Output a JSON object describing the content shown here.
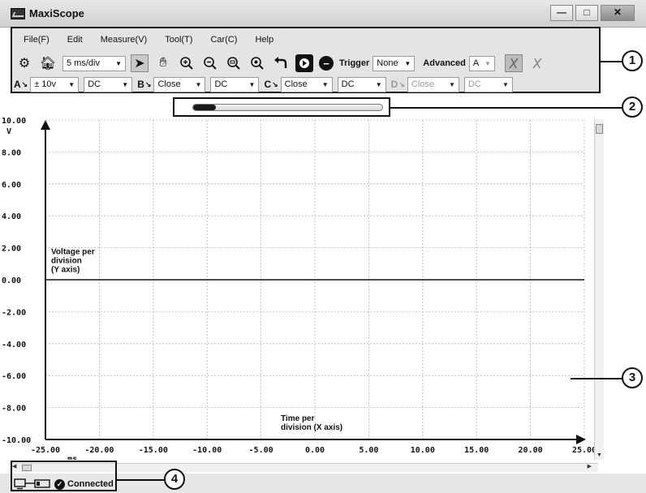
{
  "window": {
    "title": "MaxiScope",
    "minimize": "—",
    "maximize": "□",
    "close": "✕"
  },
  "menu": [
    "File(F)",
    "Edit",
    "Measure(V)",
    "Tool(T)",
    "Car(C)",
    "Help"
  ],
  "toolbar": {
    "timebase": "5  ms/div",
    "trigger_label": "Trigger",
    "trigger_value": "None",
    "advanced_label": "Advanced",
    "advanced_value": "A",
    "icons": [
      "gear-icon",
      "home-icon",
      "pointer-icon",
      "hand-icon",
      "zoom-in-icon",
      "zoom-out-icon",
      "zoom-fit-icon",
      "zoom-reset-icon",
      "undo-icon",
      "run-icon",
      "stop-icon",
      "cursor-icon",
      "cursor-off-icon"
    ]
  },
  "channels": [
    {
      "label": "A",
      "range": "±  10v",
      "coupling": "DC",
      "enabled": true
    },
    {
      "label": "B",
      "range": "Close",
      "coupling": "DC",
      "enabled": true
    },
    {
      "label": "C",
      "range": "Close",
      "coupling": "DC",
      "enabled": true
    },
    {
      "label": "D",
      "range": "Close",
      "coupling": "DC",
      "enabled": false
    }
  ],
  "progress": {
    "fraction": 0.12
  },
  "callouts": [
    "1",
    "2",
    "3",
    "4"
  ],
  "chart_data": {
    "type": "line",
    "y_unit": "V",
    "x_unit": "ms",
    "yticks": [
      "10.00",
      "8.00",
      "6.00",
      "4.00",
      "2.00",
      "0.00",
      "-2.00",
      "-4.00",
      "-6.00",
      "-8.00",
      "-10.00"
    ],
    "xticks": [
      "-25.00",
      "-20.00",
      "-15.00",
      "-10.00",
      "-5.00",
      "0.00",
      "5.00",
      "10.00",
      "15.00",
      "20.00",
      "25.00"
    ],
    "xlim": [
      -25,
      25
    ],
    "ylim": [
      -10,
      10
    ],
    "series": [
      {
        "x": [
          -25,
          25
        ],
        "y": [
          0,
          0
        ]
      }
    ],
    "grid": true,
    "annotation_y_lines": [
      "Voltage per",
      "division",
      "(Y axis)"
    ],
    "annotation_x_lines": [
      "Time per",
      "division (X axis)"
    ]
  },
  "status": {
    "connection": "Connected"
  }
}
